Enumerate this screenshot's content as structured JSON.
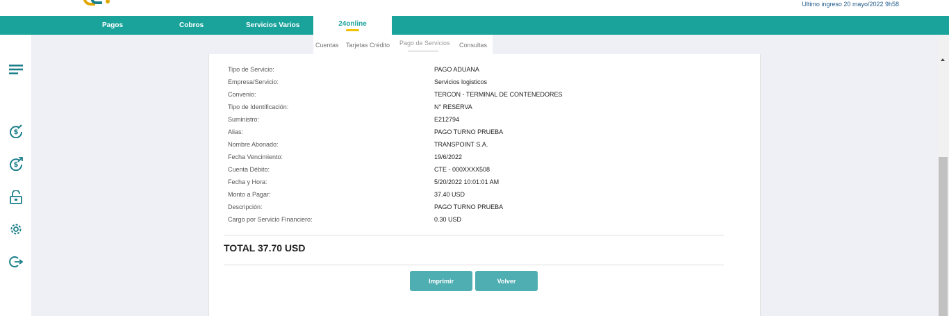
{
  "header": {
    "last_login": "Ultimo ingreso 20 mayo/2022 9h58"
  },
  "nav": {
    "items": [
      {
        "label": "Pagos"
      },
      {
        "label": "Cobros"
      },
      {
        "label": "Servicios Varios"
      },
      {
        "label": "24online",
        "active": true
      }
    ]
  },
  "subnav": {
    "items": [
      {
        "label": "Cuentas"
      },
      {
        "label": "Tarjetas Crédito"
      },
      {
        "label": "Pago de Servicios",
        "active": true
      },
      {
        "label": "Consultas"
      }
    ]
  },
  "sidebar": {
    "icons": [
      "menu-icon",
      "pay-dollar-icon",
      "transfer-dollar-icon",
      "unlock-icon",
      "settings-gear-icon",
      "logout-icon"
    ]
  },
  "details": {
    "rows": [
      {
        "label": "Tipo de Servicio:",
        "value": "PAGO ADUANA"
      },
      {
        "label": "Empresa/Servicio:",
        "value": "Servicios logisticos"
      },
      {
        "label": "Convenio:",
        "value": "TERCON - TERMINAL DE CONTENEDORES"
      },
      {
        "label": "Tipo de Identificación:",
        "value": "N° RESERVA"
      },
      {
        "label": "Suministro:",
        "value": "E212794"
      },
      {
        "label": "Alias:",
        "value": "PAGO TURNO PRUEBA"
      },
      {
        "label": "Nombre Abonado:",
        "value": "TRANSPOINT S.A."
      },
      {
        "label": "Fecha Vencimiento:",
        "value": "19/6/2022"
      },
      {
        "label": "Cuenta Débito:",
        "value": "CTE - 000XXXX508"
      },
      {
        "label": "Fecha y Hora:",
        "value": "5/20/2022 10:01:01 AM"
      },
      {
        "label": "Monto a Pagar:",
        "value": "37.40 USD"
      },
      {
        "label": "Descripción:",
        "value": "PAGO TURNO PRUEBA"
      },
      {
        "label": "Cargo por Servicio Financiero:",
        "value": "0.30 USD"
      }
    ],
    "total": "TOTAL 37.70 USD"
  },
  "actions": {
    "print_label": "Imprimir",
    "back_label": "Volver"
  },
  "colors": {
    "nav_bg": "#1aa39b",
    "accent_yellow": "#f2c200",
    "button_bg": "#4faeb2",
    "icon_color": "#1b7f8a",
    "content_bg": "#eef0f5"
  }
}
